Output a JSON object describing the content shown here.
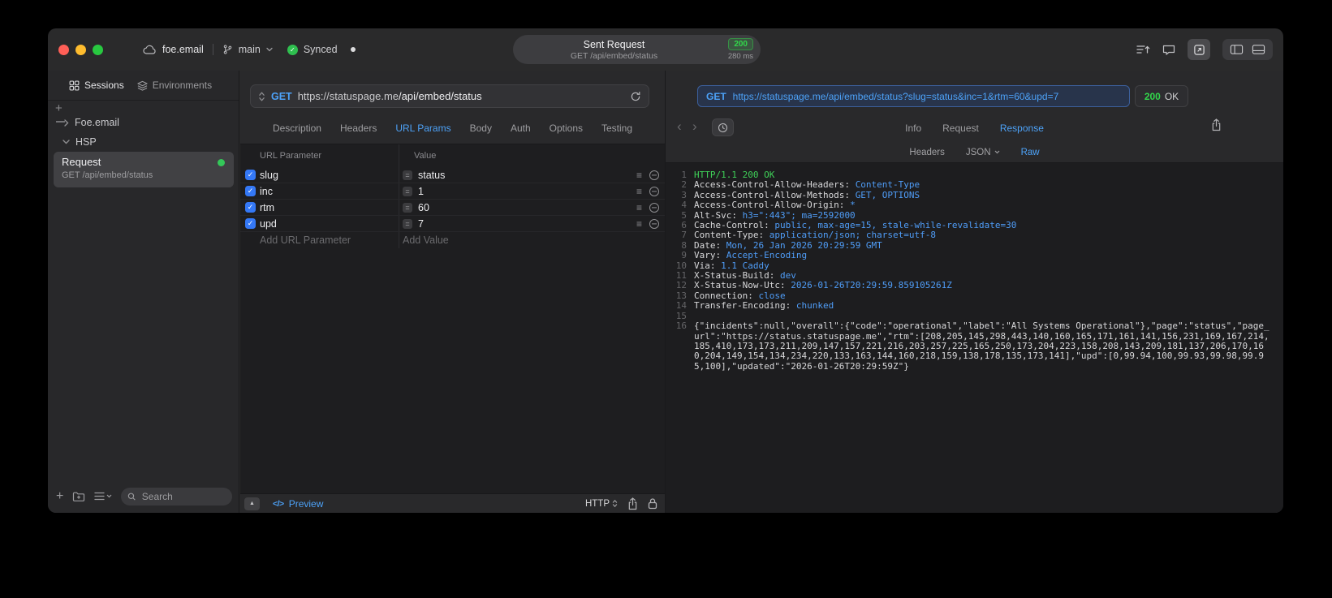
{
  "titlebar": {
    "project_name": "foe.email",
    "branch_name": "main",
    "sync_label": "Synced",
    "center": {
      "title": "Sent Request",
      "subtitle": "GET /api/embed/status",
      "status_code": "200",
      "duration": "280 ms"
    }
  },
  "sidebar": {
    "tab_sessions": "Sessions",
    "tab_environments": "Environments",
    "group_collapsed": "Foe.email",
    "group_expanded": "HSP",
    "request_item": {
      "title": "Request",
      "subtitle": "GET /api/embed/status"
    },
    "search_placeholder": "Search"
  },
  "request_editor": {
    "method": "GET",
    "url_host": "https://statuspage.me",
    "url_path": "/api/embed/status",
    "tabs": [
      "Description",
      "Headers",
      "URL Params",
      "Body",
      "Auth",
      "Options",
      "Testing"
    ],
    "active_tab_index": 2,
    "params_table": {
      "col_param": "URL Parameter",
      "col_value": "Value",
      "rows": [
        {
          "name": "slug",
          "value": "status",
          "checked": true
        },
        {
          "name": "inc",
          "value": "1",
          "checked": true
        },
        {
          "name": "rtm",
          "value": "60",
          "checked": true
        },
        {
          "name": "upd",
          "value": "7",
          "checked": true
        }
      ],
      "add_param_placeholder": "Add URL Parameter",
      "add_value_placeholder": "Add Value"
    },
    "footer": {
      "preview_label": "Preview",
      "protocol_label": "HTTP"
    }
  },
  "response_viewer": {
    "method": "GET",
    "url": "https://statuspage.me/api/embed/status?slug=status&inc=1&rtm=60&upd=7",
    "status_code": "200",
    "status_text": "OK",
    "tabs": [
      "Info",
      "Request",
      "Response"
    ],
    "active_tab_index": 2,
    "subtabs": [
      {
        "label": "Headers"
      },
      {
        "label": "JSON",
        "dropdown": true
      },
      {
        "label": "Raw"
      }
    ],
    "active_subtab_index": 2,
    "raw": {
      "status_line": "HTTP/1.1 200 OK",
      "headers": [
        {
          "name": "Access-Control-Allow-Headers",
          "value": "Content-Type"
        },
        {
          "name": "Access-Control-Allow-Methods",
          "value": "GET, OPTIONS"
        },
        {
          "name": "Access-Control-Allow-Origin",
          "value": "*"
        },
        {
          "name": "Alt-Svc",
          "value": "h3=\":443\"; ma=2592000"
        },
        {
          "name": "Cache-Control",
          "value": "public, max-age=15, stale-while-revalidate=30"
        },
        {
          "name": "Content-Type",
          "value": "application/json; charset=utf-8"
        },
        {
          "name": "Date",
          "value": "Mon, 26 Jan 2026 20:29:59 GMT"
        },
        {
          "name": "Vary",
          "value": "Accept-Encoding"
        },
        {
          "name": "Via",
          "value": "1.1 Caddy"
        },
        {
          "name": "X-Status-Build",
          "value": "dev"
        },
        {
          "name": "X-Status-Now-Utc",
          "value": "2026-01-26T20:29:59.859105261Z"
        },
        {
          "name": "Connection",
          "value": "close"
        },
        {
          "name": "Transfer-Encoding",
          "value": "chunked"
        }
      ],
      "body": "{\"incidents\":null,\"overall\":{\"code\":\"operational\",\"label\":\"All Systems Operational\"},\"page\":\"status\",\"page_url\":\"https://status.statuspage.me\",\"rtm\":[208,205,145,298,443,140,160,165,171,161,141,156,231,169,167,214,185,410,173,173,211,209,147,157,221,216,203,257,225,165,250,173,204,223,158,208,143,209,181,137,206,170,160,204,149,154,134,234,220,133,163,144,160,218,159,138,178,135,173,141],\"upd\":[0,99.94,100,99.93,99.98,99.95,100],\"updated\":\"2026-01-26T20:29:59Z\"}"
    }
  },
  "icons": {
    "check": "✓",
    "equals": "=",
    "drag": "≡",
    "expand": "▲",
    "code": "</>",
    "back": "‹",
    "forward": "›"
  },
  "colors": {
    "accent_blue": "#4da2f8",
    "status_green": "#32d74b"
  }
}
